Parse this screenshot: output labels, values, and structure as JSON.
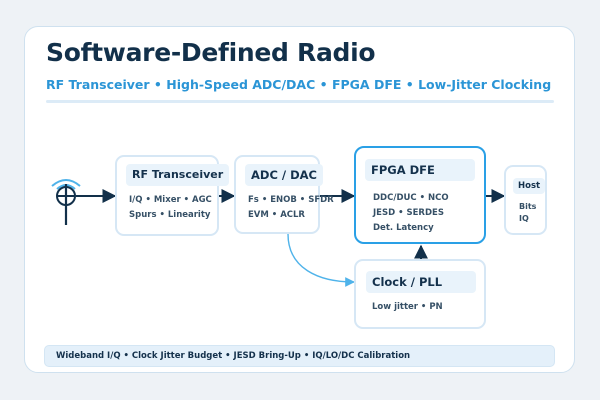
{
  "header": {
    "title": "Software-Defined Radio",
    "subtitle": "RF Transceiver • High-Speed ADC/DAC • FPGA DFE • Low-Jitter Clocking"
  },
  "blocks": {
    "rf": {
      "label": "RF Transceiver",
      "lines": [
        "I/Q • Mixer • AGC",
        "Spurs • Linearity"
      ]
    },
    "adc": {
      "label": "ADC / DAC",
      "lines": [
        "Fs • ENOB • SFDR",
        "EVM • ACLR"
      ]
    },
    "fpga": {
      "label": "FPGA DFE",
      "lines": [
        "DDC/DUC • NCO",
        "JESD • SERDES",
        "Det. Latency"
      ]
    },
    "host": {
      "label": "Host",
      "lines": [
        "Bits",
        "IQ"
      ]
    },
    "clock": {
      "label": "Clock / PLL",
      "lines": [
        "Low jitter • PN"
      ]
    }
  },
  "icons": {
    "antenna": "antenna-icon"
  },
  "footer": {
    "text": "Wideband I/Q • Clock Jitter Budget • JESD Bring-Up • IQ/LO/DC Calibration"
  },
  "colors": {
    "accent": "#2aa0e6",
    "title": "#12304a",
    "subtitle": "#2b95d6",
    "border": "#d6e7f5",
    "chip": "#e9f3fb"
  }
}
